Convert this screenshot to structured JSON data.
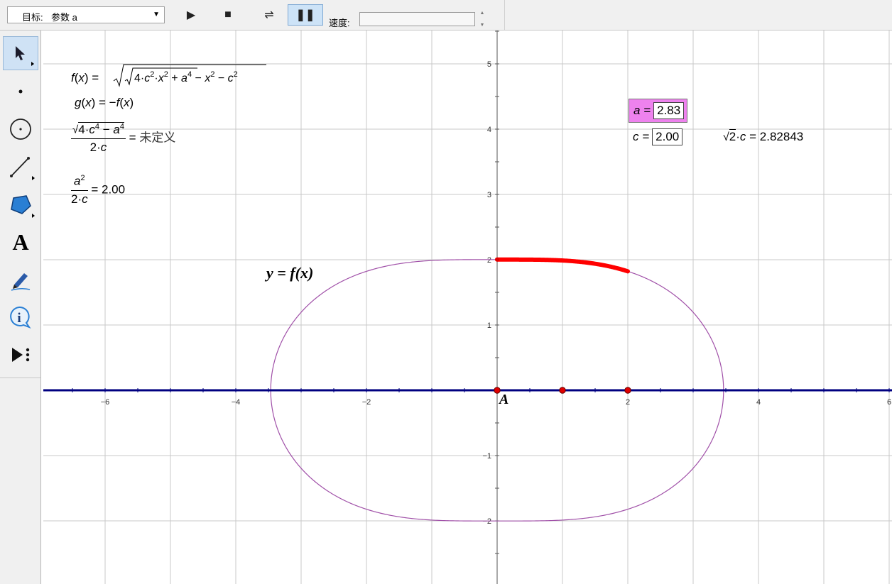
{
  "toolbar": {
    "target_label": "目标:",
    "target_value": "参数 a",
    "speed_label": "速度:",
    "speed_value": "",
    "buttons": [
      "play",
      "stop",
      "reverse",
      "pause"
    ]
  },
  "tools": [
    "arrow-select",
    "point",
    "compass",
    "straightedge",
    "polygon",
    "text",
    "marker",
    "information",
    "custom-tools"
  ],
  "formulas": {
    "f": "f(x) = √(√(4·c²·x² + a⁴) − x² − c²)",
    "g": "g(x) = −f(x)",
    "expr1": "√(4·c⁴ − a⁴) / (2·c) = 未定义",
    "expr1_value": "未定义",
    "expr2": "a² / (2·c) = 2.00",
    "expr2_value": "2.00"
  },
  "params": {
    "a_label": "a =",
    "a_value": "2.83",
    "c_label": "c =",
    "c_value": "2.00"
  },
  "readout": {
    "expr": "√2·c",
    "value": "2.82843"
  },
  "labels": {
    "curve": "y = f(x)",
    "point": "A"
  },
  "axes": {
    "x_ticks": [
      "−6",
      "−4",
      "−2",
      "2",
      "4",
      "6"
    ],
    "y_ticks": [
      "5",
      "4",
      "3",
      "2",
      "1",
      "−1",
      "−2"
    ]
  },
  "colors": {
    "axis": "#000080",
    "curve": "#a050a8",
    "trace": "#ff0000",
    "point": "#e00000",
    "grid": "#c8c8c8",
    "param_highlight": "#ee82ee"
  },
  "chart_data": {
    "type": "line",
    "xlim": [
      -6.7,
      6
    ],
    "ylim": [
      -3,
      5.4
    ],
    "grid": true,
    "a": 2.83,
    "c": 2.0,
    "points": [
      {
        "name": "A",
        "x": 0,
        "y": 0
      },
      {
        "name": "",
        "x": 1,
        "y": 0
      },
      {
        "name": "",
        "x": 2,
        "y": 0
      }
    ],
    "trace": {
      "from_x": 0,
      "to_x": 2
    }
  }
}
